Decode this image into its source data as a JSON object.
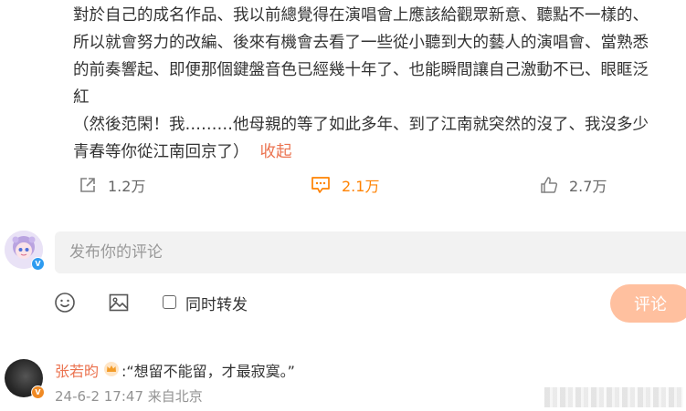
{
  "post": {
    "lines": [
      "對於自己的成名作品、我以前總覺得在演唱會上應該給觀眾新意、聽點不一樣的、",
      "所以就會努力的改編、後來有機會去看了一些從小聽到大的藝人的演唱會、當熟悉",
      "的前奏響起、即便那個鍵盤音色已經幾十年了、也能瞬間讓自己激動不已、眼眶泛",
      "紅",
      "（然後范閑！我………他母親的等了如此多年、到了江南就突然的沒了、我沒多少",
      "青春等你從江南回京了）"
    ],
    "collapse_label": "收起"
  },
  "actions": {
    "share_count": "1.2万",
    "comment_count": "2.1万",
    "like_count": "2.7万"
  },
  "composer": {
    "placeholder": "发布你的评论",
    "repost_label": "同时转发",
    "submit_label": "评论"
  },
  "comment": {
    "author": "张若昀",
    "text": ":“想留不能留，才最寂寞。”",
    "meta": "24-6-2 17:47 来自北京"
  },
  "colors": {
    "accent": "#ff8200",
    "link": "#eb7350",
    "submit_bg": "#ffc09f",
    "badge_blue": "#2d9bf0",
    "badge_orange": "#f08a24"
  },
  "icons": [
    "share-icon",
    "comment-icon",
    "like-icon",
    "emoji-icon",
    "image-icon",
    "crown-icon",
    "verified-badge-icon"
  ]
}
